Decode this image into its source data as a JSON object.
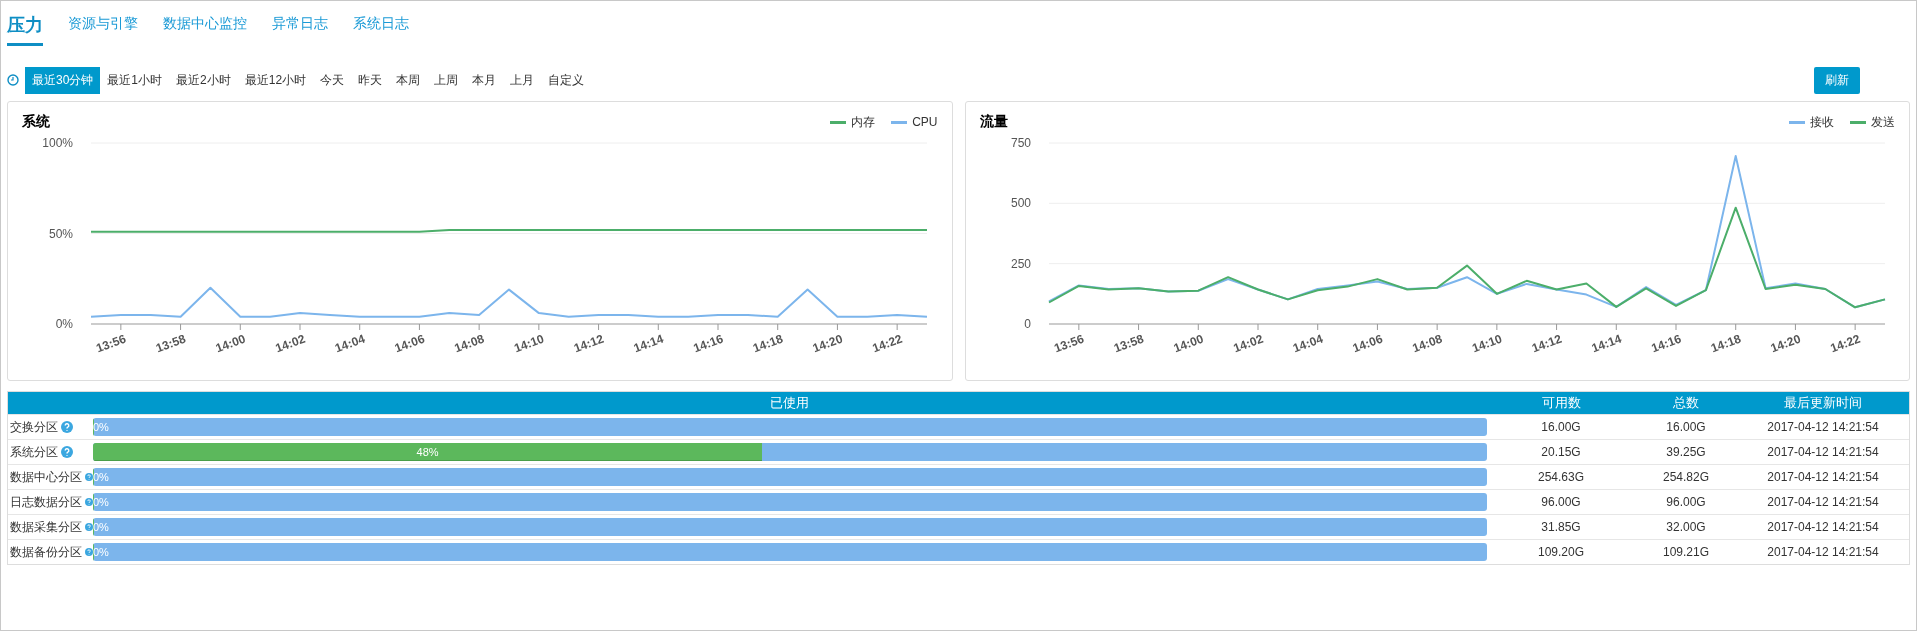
{
  "tabs": [
    {
      "label": "压力",
      "selected": true
    },
    {
      "label": "资源与引擎",
      "selected": false
    },
    {
      "label": "数据中心监控",
      "selected": false
    },
    {
      "label": "异常日志",
      "selected": false
    },
    {
      "label": "系统日志",
      "selected": false
    }
  ],
  "time_ranges": [
    {
      "label": "最近30分钟",
      "selected": true
    },
    {
      "label": "最近1小时",
      "selected": false
    },
    {
      "label": "最近2小时",
      "selected": false
    },
    {
      "label": "最近12小时",
      "selected": false
    },
    {
      "label": "今天",
      "selected": false
    },
    {
      "label": "昨天",
      "selected": false
    },
    {
      "label": "本周",
      "selected": false
    },
    {
      "label": "上周",
      "selected": false
    },
    {
      "label": "本月",
      "selected": false
    },
    {
      "label": "上月",
      "selected": false
    },
    {
      "label": "自定义",
      "selected": false
    }
  ],
  "refresh_button": "刷新",
  "charts": [
    {
      "title": "系统",
      "chart_data": {
        "type": "line",
        "x": [
          835,
          836,
          837,
          838,
          839,
          840,
          841,
          842,
          843,
          844,
          845,
          846,
          847,
          848,
          849,
          850,
          851,
          852,
          853,
          854,
          855,
          856,
          857,
          858,
          859,
          860,
          861,
          862,
          863
        ],
        "xlim": [
          835,
          863
        ],
        "xticks": [
          {
            "value": 836,
            "label": "13:56"
          },
          {
            "value": 838,
            "label": "13:58"
          },
          {
            "value": 840,
            "label": "14:00"
          },
          {
            "value": 842,
            "label": "14:02"
          },
          {
            "value": 844,
            "label": "14:04"
          },
          {
            "value": 846,
            "label": "14:06"
          },
          {
            "value": 848,
            "label": "14:08"
          },
          {
            "value": 850,
            "label": "14:10"
          },
          {
            "value": 852,
            "label": "14:12"
          },
          {
            "value": 854,
            "label": "14:14"
          },
          {
            "value": 856,
            "label": "14:16"
          },
          {
            "value": 858,
            "label": "14:18"
          },
          {
            "value": 860,
            "label": "14:20"
          },
          {
            "value": 862,
            "label": "14:22"
          }
        ],
        "ylim": [
          0,
          100
        ],
        "yticks": [
          {
            "value": 0,
            "label": "0%"
          },
          {
            "value": 50,
            "label": "50%"
          },
          {
            "value": 100,
            "label": "100%"
          }
        ],
        "series": [
          {
            "name": "内存",
            "color": "#4cae6a",
            "values": [
              51,
              51,
              51,
              51,
              51,
              51,
              51,
              51,
              51,
              51,
              51,
              51,
              52,
              52,
              52,
              52,
              52,
              52,
              52,
              52,
              52,
              52,
              52,
              52,
              52,
              52,
              52,
              52,
              52
            ]
          },
          {
            "name": "CPU",
            "color": "#7cb5ec",
            "values": [
              4,
              5,
              5,
              4,
              20,
              4,
              4,
              6,
              5,
              4,
              4,
              4,
              6,
              5,
              19,
              6,
              4,
              5,
              5,
              4,
              4,
              5,
              5,
              4,
              19,
              4,
              4,
              5,
              4
            ]
          }
        ]
      }
    },
    {
      "title": "流量",
      "chart_data": {
        "type": "line",
        "x": [
          835,
          836,
          837,
          838,
          839,
          840,
          841,
          842,
          843,
          844,
          845,
          846,
          847,
          848,
          849,
          850,
          851,
          852,
          853,
          854,
          855,
          856,
          857,
          858,
          859,
          860,
          861,
          862,
          863
        ],
        "xlim": [
          835,
          863
        ],
        "xticks": [
          {
            "value": 836,
            "label": "13:56"
          },
          {
            "value": 838,
            "label": "13:58"
          },
          {
            "value": 840,
            "label": "14:00"
          },
          {
            "value": 842,
            "label": "14:02"
          },
          {
            "value": 844,
            "label": "14:04"
          },
          {
            "value": 846,
            "label": "14:06"
          },
          {
            "value": 848,
            "label": "14:08"
          },
          {
            "value": 850,
            "label": "14:10"
          },
          {
            "value": 852,
            "label": "14:12"
          },
          {
            "value": 854,
            "label": "14:14"
          },
          {
            "value": 856,
            "label": "14:16"
          },
          {
            "value": 858,
            "label": "14:18"
          },
          {
            "value": 860,
            "label": "14:20"
          },
          {
            "value": 862,
            "label": "14:22"
          }
        ],
        "ylim": [
          0,
          750
        ],
        "yticks": [
          {
            "value": 0,
            "label": "0"
          },
          {
            "value": 250,
            "label": "250"
          },
          {
            "value": 500,
            "label": "500"
          },
          {
            "value": 750,
            "label": "750"
          }
        ],
        "series": [
          {
            "name": "接收",
            "color": "#7cb5ec",
            "values": [
              94,
              160,
              145,
              148,
              135,
              138,
              186,
              143,
              102,
              145,
              160,
              176,
              145,
              150,
              194,
              125,
              166,
              143,
              122,
              71,
              153,
              79,
              140,
              696,
              148,
              168,
              145,
              69,
              102
            ]
          },
          {
            "name": "发送",
            "color": "#4cae6a",
            "values": [
              89,
              158,
              143,
              148,
              135,
              138,
              194,
              143,
              102,
              140,
              155,
              186,
              143,
              150,
              242,
              125,
              179,
              143,
              168,
              71,
              148,
              75,
              140,
              482,
              145,
              163,
              145,
              69,
              102
            ]
          }
        ]
      }
    }
  ],
  "table": {
    "columns": [
      "已使用",
      "可用数",
      "总数",
      "最后更新时间"
    ],
    "rows": [
      {
        "name": "交换分区",
        "level": 0,
        "usage": "0%",
        "available": "16.00G",
        "total": "16.00G",
        "updated": "2017-04-12 14:21:54"
      },
      {
        "name": "系统分区",
        "level": 0.48,
        "usage": "48%",
        "available": "20.15G",
        "total": "39.25G",
        "updated": "2017-04-12 14:21:54"
      },
      {
        "name": "数据中心分区",
        "level": 0,
        "usage": "0%",
        "available": "254.63G",
        "total": "254.82G",
        "updated": "2017-04-12 14:21:54"
      },
      {
        "name": "日志数据分区",
        "level": 0,
        "usage": "0%",
        "available": "96.00G",
        "total": "96.00G",
        "updated": "2017-04-12 14:21:54"
      },
      {
        "name": "数据采集分区",
        "level": 0,
        "usage": "0%",
        "available": "31.85G",
        "total": "32.00G",
        "updated": "2017-04-12 14:21:54"
      },
      {
        "name": "数据备份分区",
        "level": 0,
        "usage": "0%",
        "available": "109.20G",
        "total": "109.21G",
        "updated": "2017-04-12 14:21:54"
      }
    ]
  }
}
